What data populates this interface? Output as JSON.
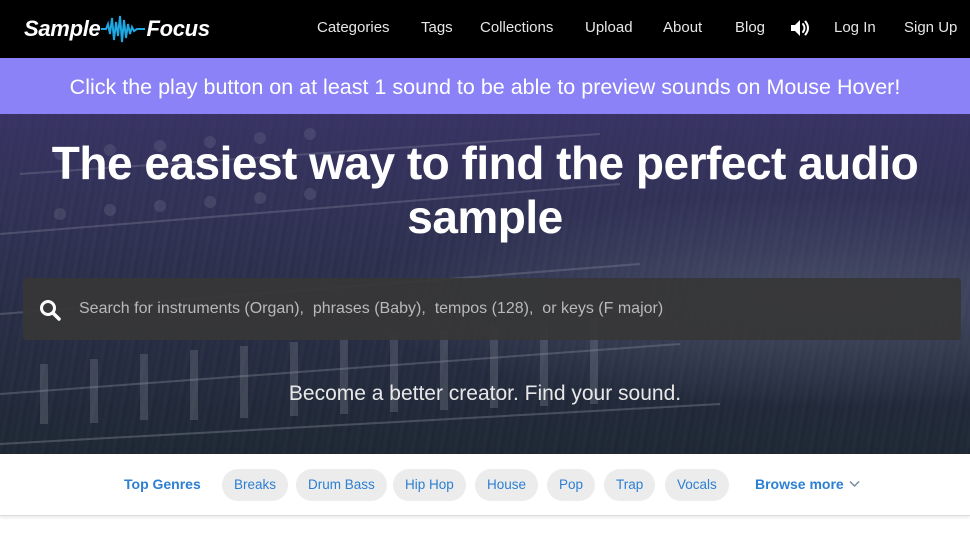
{
  "header": {
    "logo_left": "Sample",
    "logo_right": "Focus",
    "nav": [
      {
        "label": "Categories"
      },
      {
        "label": "Tags"
      },
      {
        "label": "Collections"
      },
      {
        "label": "Upload"
      },
      {
        "label": "About"
      },
      {
        "label": "Blog"
      }
    ],
    "speaker_icon": "speaker-icon",
    "login": "Log In",
    "signup": "Sign Up"
  },
  "notice": {
    "text": "Click the play button on at least 1 sound to be able to preview sounds on Mouse Hover!"
  },
  "hero": {
    "title_line1": "The easiest way to find the perfect audio",
    "title_line2": "sample",
    "search_placeholder": "Search for instruments (Organ),  phrases (Baby),  tempos (128),  or keys (F major)",
    "tagline": "Become a better creator. Find your sound."
  },
  "genres": {
    "label": "Top Genres",
    "items": [
      "Breaks",
      "Drum Bass",
      "Hip Hop",
      "House",
      "Pop",
      "Trap",
      "Vocals"
    ],
    "browse_more": "Browse more"
  },
  "colors": {
    "nav_bg": "#000000",
    "notice_bg": "#8a82f6",
    "link_blue": "#2c7fd3",
    "chip_bg": "#ececec"
  }
}
